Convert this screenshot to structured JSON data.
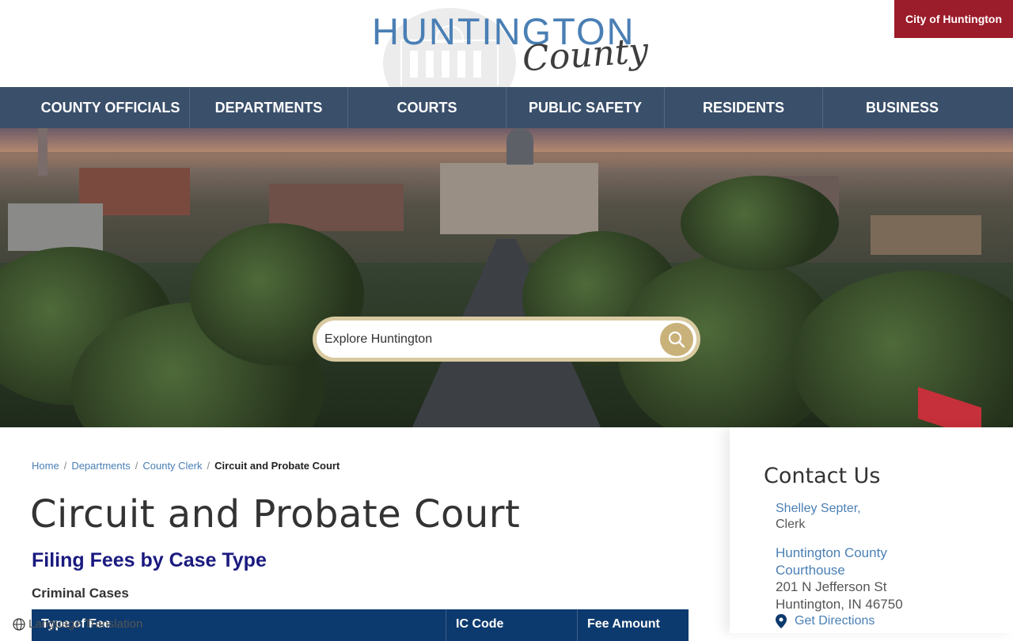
{
  "header": {
    "logo_main": "HUNTINGTON",
    "logo_sub": "County",
    "city_link": "City of Huntington"
  },
  "nav": {
    "items": [
      {
        "label": "COUNTY OFFICIALS"
      },
      {
        "label": "DEPARTMENTS"
      },
      {
        "label": "COURTS"
      },
      {
        "label": "PUBLIC SAFETY"
      },
      {
        "label": "RESIDENTS"
      },
      {
        "label": "BUSINESS"
      }
    ]
  },
  "search": {
    "placeholder": "Explore Huntington",
    "icon": "search-icon"
  },
  "breadcrumb": {
    "items": [
      "Home",
      "Departments",
      "County Clerk"
    ],
    "current": "Circuit and Probate Court"
  },
  "page": {
    "title": "Circuit and Probate Court",
    "section_title": "Filing Fees by Case Type",
    "sub_title": "Criminal Cases",
    "table_headers": [
      "Type of Fee",
      "IC Code",
      "Fee Amount"
    ]
  },
  "language": {
    "label": "Language Translation",
    "icon": "globe-icon"
  },
  "sidebar": {
    "title": "Contact Us",
    "name": "Shelley Septer,",
    "role": "Clerk",
    "org": "Huntington County Courthouse",
    "address1": "201 N Jefferson St",
    "address2": "Huntington, IN 46750",
    "directions": "Get Directions",
    "directions_icon": "map-pin-icon"
  },
  "colors": {
    "nav_bg": "#3a4f6a",
    "accent_red": "#9b1c2a",
    "link_blue": "#4a7fb5",
    "table_head": "#0d3a6e",
    "heading_navy": "#1a1a80",
    "search_gold": "#c9b27a"
  }
}
